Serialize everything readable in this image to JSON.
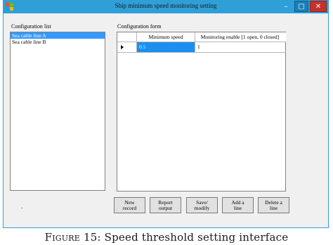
{
  "window": {
    "title": "Ship minimum speed monitoring setting",
    "controls": [
      "minimize",
      "maximize",
      "close"
    ]
  },
  "config_list": {
    "label": "Configuration list",
    "items": [
      {
        "label": "Sea cable line A",
        "selected": true
      },
      {
        "label": "Sea cable line B",
        "selected": false
      }
    ]
  },
  "config_form": {
    "label": "Configuration form",
    "columns": [
      "Minimum speed",
      "Monitoring enable [1 open, 0 closed]"
    ],
    "rows": [
      {
        "minimum_speed": "0.5",
        "monitoring_enable": "1",
        "current": true
      }
    ]
  },
  "buttons": {
    "new_record": "New\nrecord",
    "report_output": "Report\noutput",
    "save_modify": "Save/\nmodify",
    "add_line": "Add a\nline",
    "delete_line": "Delete a\nline"
  },
  "status_mark": ".",
  "caption": {
    "figure": "Figure 15:",
    "text": "Speed threshold setting interface"
  },
  "colors": {
    "titlebar": "#2f9fd8",
    "selection": "#3399ff",
    "close_button": "#c7312c"
  }
}
